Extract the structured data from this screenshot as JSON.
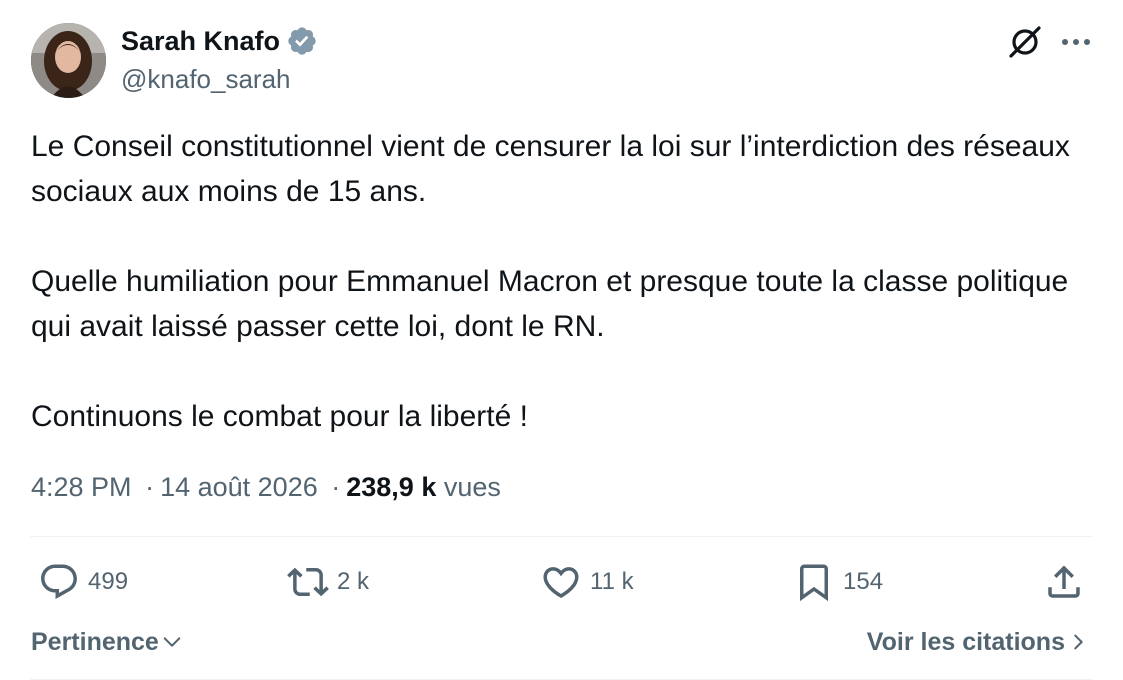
{
  "author": {
    "display_name": "Sarah Knafo",
    "handle": "@knafo_sarah",
    "verified": true
  },
  "tweet": {
    "paragraphs": [
      "Le Conseil constitutionnel vient de censurer la loi sur l’interdiction des réseaux sociaux aux moins de 15 ans.",
      "Quelle humiliation pour Emmanuel Macron et presque toute la classe politique qui avait laissé passer cette loi, dont le RN.",
      "Continuons le combat pour la liberté !"
    ],
    "time": "4:28 PM",
    "date": "14 août 2026",
    "separator": "·",
    "views_count": "238,9 k",
    "views_label": "vues"
  },
  "actions": {
    "replies": "499",
    "reposts": "2 k",
    "likes": "11 k",
    "bookmarks": "154"
  },
  "footer": {
    "sort_label": "Pertinence",
    "quotes_label": "Voir les citations"
  },
  "colors": {
    "text_primary": "#0f1419",
    "text_secondary": "#536471",
    "verified": "#829aab",
    "divider": "#eff3f4"
  },
  "icons": {
    "grok": "grok-icon",
    "more": "more-icon",
    "reply": "reply-icon",
    "repost": "repost-icon",
    "like": "heart-icon",
    "bookmark": "bookmark-icon",
    "share": "share-icon"
  }
}
